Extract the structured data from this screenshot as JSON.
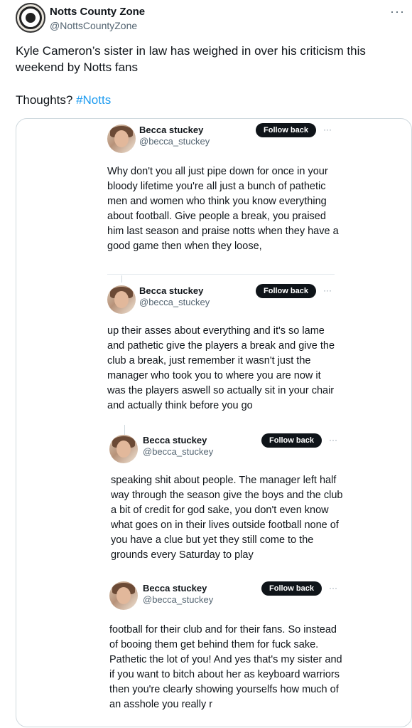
{
  "tweet": {
    "author_name": "Notts County Zone",
    "author_handle": "@NottsCountyZone",
    "avatar_icon": "notts-county-crest",
    "more_icon": "more-horizontal-icon",
    "text_line1": "Kyle Cameron’s sister in law has weighed in over his criticism this weekend by Notts fans",
    "text_line2_prefix": "Thoughts? ",
    "hashtag": "#Notts"
  },
  "embedded_posts": [
    {
      "name": "Becca stuckey",
      "handle": "@becca_stuckey",
      "follow_label": "Follow back",
      "more": "···",
      "body": "Why don't you all just pipe down for once in your bloody lifetime you're all just a bunch of pathetic men and women who think you know everything about football. Give people a break, you praised him last season and praise notts when they have a good game then when they loose,"
    },
    {
      "name": "Becca stuckey",
      "handle": "@becca_stuckey",
      "follow_label": "Follow back",
      "more": "···",
      "body": "up their asses about everything and it's so lame and pathetic give the players a break and give the club a break, just remember it wasn't just the manager who took you to where you are now it was the players aswell so actually sit in your chair and actually think before you go"
    },
    {
      "name": "Becca stuckey",
      "handle": "@becca_stuckey",
      "follow_label": "Follow back",
      "more": "···",
      "body": "speaking shit about people. The manager left half way through the season give the boys and the club a bit of credit for god sake, you don't even know what goes on in their lives outside football none of you have a clue but yet they still come to the grounds every Saturday to play"
    },
    {
      "name": "Becca stuckey",
      "handle": "@becca_stuckey",
      "follow_label": "Follow back",
      "more": "···",
      "body": "football for their club and for their fans. So instead of booing them get behind them for fuck sake. Pathetic the lot of you! And yes that's my sister and if you want to bitch about her as keyboard warriors then you're clearly showing yourselfs how much of an asshole you really r"
    }
  ]
}
